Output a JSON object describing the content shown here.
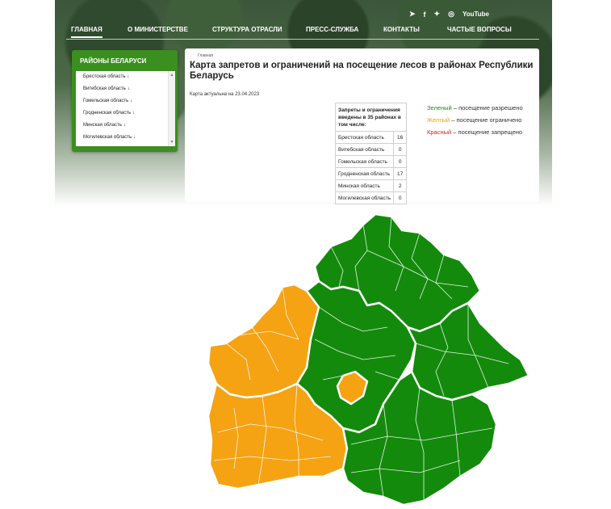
{
  "header": {
    "social": [
      {
        "icon": "telegram-icon",
        "glyph": "➤"
      },
      {
        "icon": "facebook-icon",
        "glyph": "f"
      },
      {
        "icon": "twitter-icon",
        "glyph": "✦"
      },
      {
        "icon": "instagram-icon",
        "glyph": "◎"
      },
      {
        "icon": "youtube-icon",
        "glyph": "YouTube"
      }
    ],
    "nav": [
      {
        "label": "ГЛАВНАЯ",
        "active": true
      },
      {
        "label": "О МИНИСТЕРСТВЕ"
      },
      {
        "label": "СТРУКТУРА ОТРАСЛИ"
      },
      {
        "label": "ПРЕСС-СЛУЖБА"
      },
      {
        "label": "КОНТАКТЫ"
      },
      {
        "label": "ЧАСТЫЕ ВОПРОСЫ"
      }
    ]
  },
  "sidebar": {
    "title": "РАЙОНЫ БЕЛАРУСИ",
    "items": [
      {
        "label": "Брестская область",
        "arrow": "↓"
      },
      {
        "label": "Витебская область",
        "arrow": "↓"
      },
      {
        "label": "Гомельская область",
        "arrow": "↓"
      },
      {
        "label": "Гродненская область",
        "arrow": "↓"
      },
      {
        "label": "Минская область",
        "arrow": "↓"
      },
      {
        "label": "Могилевская область",
        "arrow": "↓"
      }
    ],
    "scroll_up": "▲",
    "scroll_down": "▼"
  },
  "main": {
    "breadcrumb": "Главная",
    "title": "Карта запретов и ограничений на посещение лесов в районах Республики Беларусь",
    "actual": "Карта актуальна на 23.04.2023",
    "table": {
      "header": "Запреты и ограничения введены в 35 районах в том числе:",
      "rows": [
        {
          "region": "Брестская область",
          "count": "16"
        },
        {
          "region": "Витебская область",
          "count": "0"
        },
        {
          "region": "Гомельская область",
          "count": "0"
        },
        {
          "region": "Гродненская область",
          "count": "17"
        },
        {
          "region": "Минская область",
          "count": "2"
        },
        {
          "region": "Могилевская область",
          "count": "0"
        }
      ]
    },
    "legend": [
      {
        "color_word": "Зеленый",
        "text": " – посещение разрешено",
        "color": "#1a8a1a"
      },
      {
        "color_word": "Желтый",
        "text": " – посещение ограничено",
        "color": "#f0a000"
      },
      {
        "color_word": "Красный",
        "text": " – посещение запрещено",
        "color": "#d02020"
      }
    ],
    "map_colors": {
      "allowed": "#138a0c",
      "restricted": "#f5a312",
      "border": "#ffffff"
    }
  }
}
